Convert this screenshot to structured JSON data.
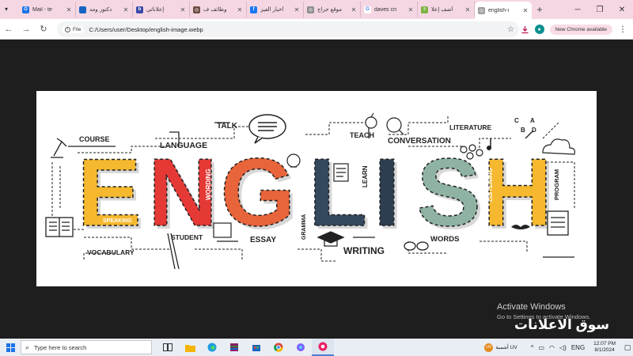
{
  "browser": {
    "tabs": [
      {
        "label": "Mail - te",
        "color": "#1a73e8",
        "glyph": "O"
      },
      {
        "label": "دكتور ومد",
        "color": "#1565c0",
        "glyph": ""
      },
      {
        "label": "إعلاناتي",
        "color": "#3949ab",
        "glyph": "b"
      },
      {
        "label": "وظائف ف",
        "color": "#6d4c41",
        "glyph": "◎"
      },
      {
        "label": "أخبار الفيز",
        "color": "#1877f2",
        "glyph": "f"
      },
      {
        "label": "موقع حراج",
        "color": "#8e8e8e",
        "glyph": "◎"
      },
      {
        "label": "daves cri",
        "color": "#ffffff",
        "glyph": "G"
      },
      {
        "label": "أضف إعلا",
        "color": "#7cb342",
        "glyph": "≡"
      },
      {
        "label": "english-i",
        "color": "#9e9e9e",
        "glyph": "◎"
      }
    ],
    "new_tab": "+",
    "address_chip": "File",
    "url": "C:/Users/user/Desktop/english-image.webp",
    "new_chrome_pill": "New Chrome available"
  },
  "overlay": {
    "activate_title": "Activate Windows",
    "activate_sub": "Go to Settings to activate Windows.",
    "site_logo": "سوق الاعلانات"
  },
  "image": {
    "word": [
      "E",
      "N",
      "G",
      "L",
      "I",
      "S",
      "H"
    ],
    "letter_colors": [
      "#f5b82e",
      "#e53935",
      "#e8643a",
      "#34495e",
      "#2c3e50",
      "#8fb3a3",
      "#f5b82e"
    ],
    "labels": {
      "course": "COURSE",
      "language": "LANGUAGE",
      "talk": "TALK",
      "teach": "TEACH",
      "literature": "LITERATURE",
      "conversation": "CONVERSATION",
      "wording": "WORDING",
      "speaking": "SPEAKING",
      "learn": "LEARN",
      "listening": "LISTENING",
      "program": "PROGRAM",
      "grammar": "GRAMMA",
      "student": "STUDENT",
      "essay": "ESSAY",
      "writing": "WRITING",
      "words": "WORDS",
      "vocabulary": "VOCABULARY",
      "a": "A",
      "b": "B",
      "c": "C",
      "d": "D"
    }
  },
  "taskbar": {
    "search_placeholder": "Type here to search",
    "weather": "أشمبة UV",
    "lang": "ENG",
    "time": "12:07 PM",
    "date": "8/1/2024"
  }
}
